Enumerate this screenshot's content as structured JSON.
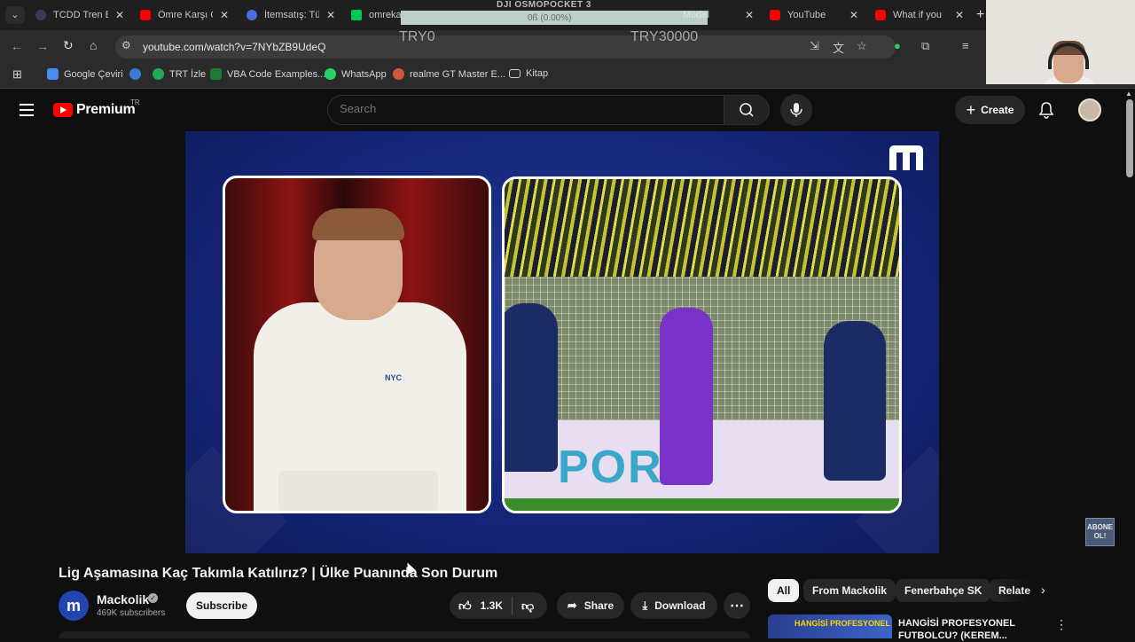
{
  "browser": {
    "tabs": [
      {
        "title": "TCDD Tren Bi",
        "favicon": "train-icon"
      },
      {
        "title": "Ömre Karşı C",
        "favicon": "youtube-icon"
      },
      {
        "title": "İtemsatış: Tü",
        "favicon": "itemsatis-icon"
      },
      {
        "title": "omreka",
        "favicon": "k-icon"
      },
      {
        "title": "Model",
        "favicon": "youtube-icon"
      },
      {
        "title": "YouTube",
        "favicon": "youtube-icon"
      },
      {
        "title": "What if you",
        "favicon": "youtube-icon"
      }
    ],
    "url": "youtube.com/watch?v=7NYbZB9UdeQ",
    "bookmarks": [
      {
        "label": "Google Çeviri",
        "icon": "translate-icon"
      },
      {
        "label": "",
        "icon": "link-icon"
      },
      {
        "label": "TRT İzle",
        "icon": "trt-icon"
      },
      {
        "label": "VBA Code Examples...",
        "icon": "vba-icon"
      },
      {
        "label": "WhatsApp",
        "icon": "whatsapp-icon"
      },
      {
        "label": "realme GT Master E...",
        "icon": "realme-icon"
      },
      {
        "label": "Kitap",
        "icon": "folder-icon"
      }
    ]
  },
  "overlay": {
    "device": "DJI OSMOPOCKET 3",
    "progress": "0ß (0.00%)",
    "left_value": "TRY0",
    "right_value": "TRY30000"
  },
  "youtube": {
    "logo_text": "Premium",
    "country": "TR",
    "search_placeholder": "Search",
    "create_label": "Create",
    "video": {
      "title": "Lig Aşamasına Kaç Takımla Katılırız? | Ülke Puanında Son Durum",
      "overlay_badge": "ABONE OL!",
      "host_shirt_text": "NYC",
      "ad_text": "PORT"
    },
    "channel": {
      "name": "Mackolik",
      "avatar_letter": "m",
      "subscribers": "469K subscribers",
      "subscribe_label": "Subscribe"
    },
    "actions": {
      "like_count": "1.3K",
      "share_label": "Share",
      "download_label": "Download"
    },
    "chips": [
      "All",
      "From Mackolik",
      "Fenerbahçe SK",
      "Relate"
    ],
    "recommended": {
      "thumb_text": "HANGİSİ PROFESYONEL",
      "title": "HANGİSİ PROFESYONEL FUTBOLCU? (KEREM..."
    }
  },
  "colors": {
    "yt_red": "#ff0000",
    "player_blue": "#16267a",
    "page_bg": "#0f0f0f"
  }
}
